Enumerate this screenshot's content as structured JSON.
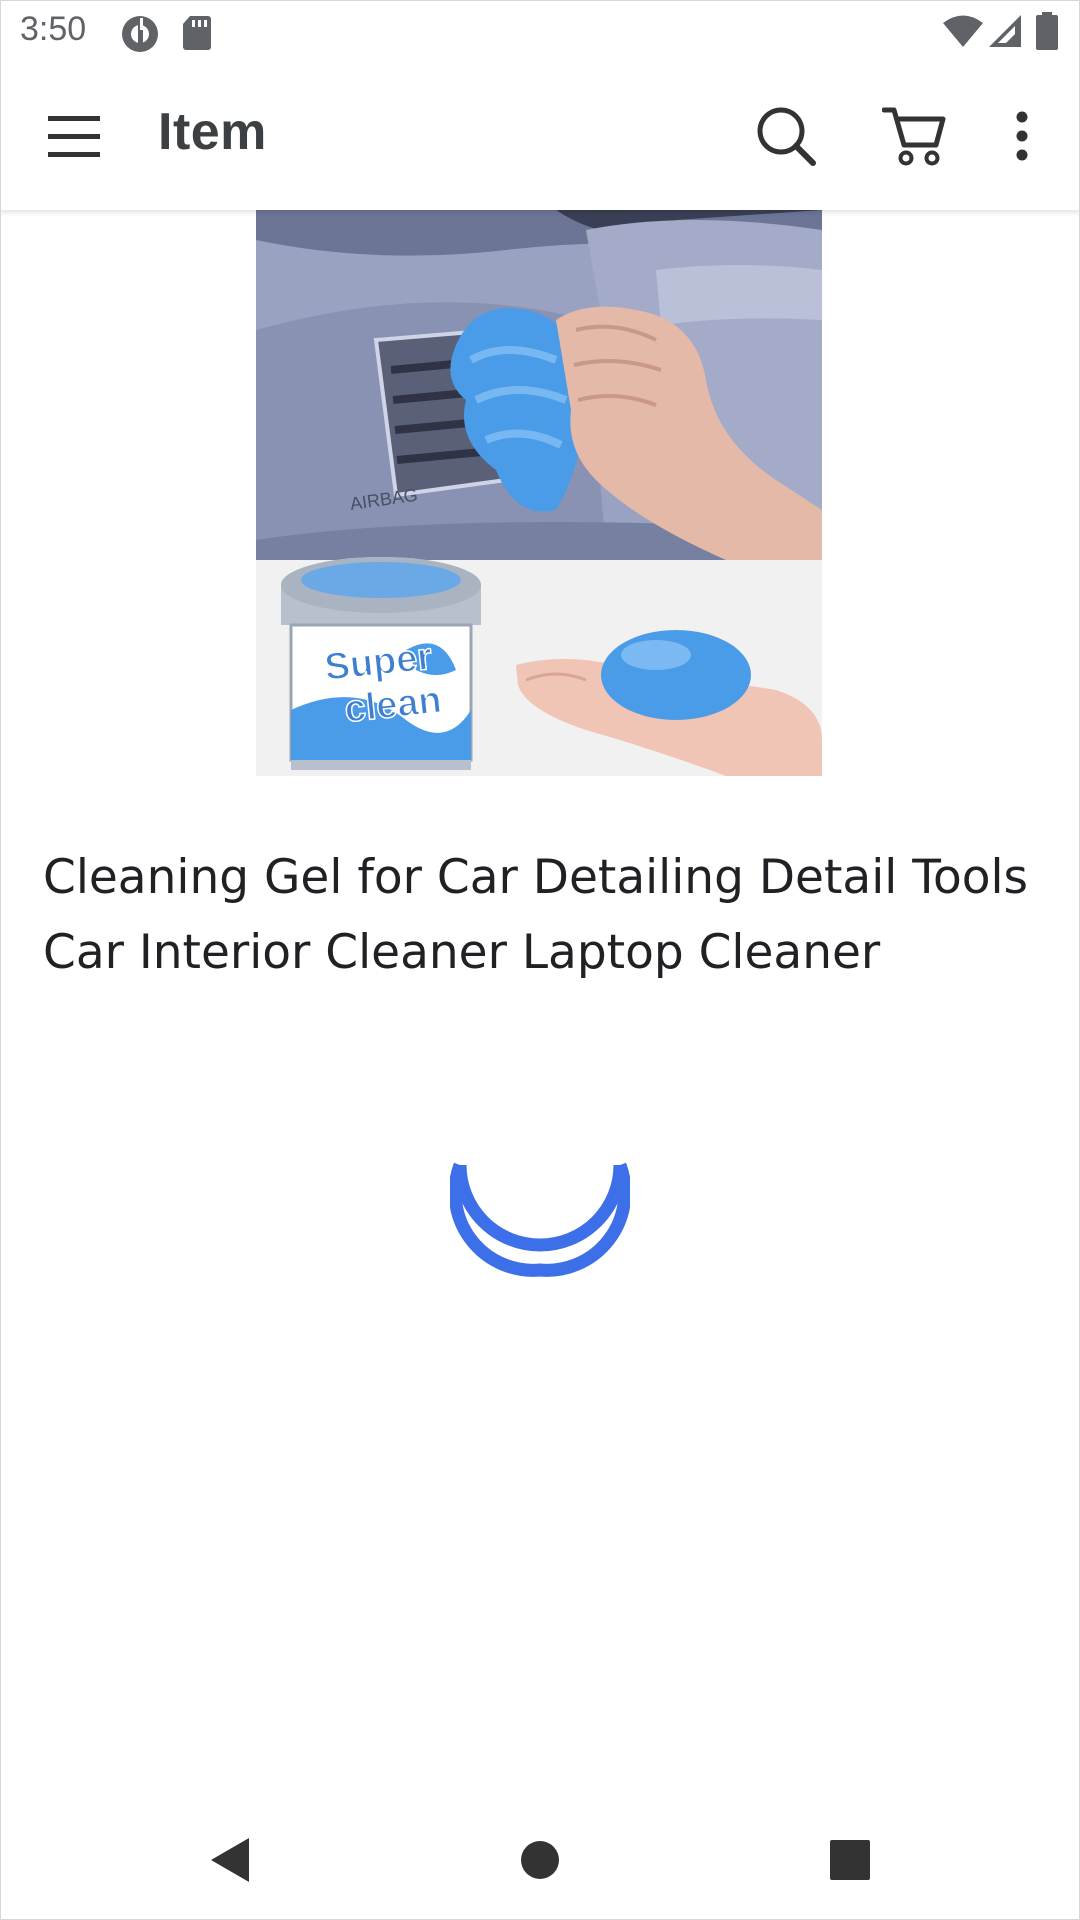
{
  "status_bar": {
    "time": "3:50",
    "icons": [
      "data-saver-icon",
      "sd-card-icon",
      "wifi-icon",
      "cellular-signal-icon",
      "battery-icon"
    ]
  },
  "app_bar": {
    "title": "Item",
    "menu_icon": "hamburger-menu-icon",
    "search_icon": "search-icon",
    "cart_icon": "shopping-cart-icon",
    "overflow_icon": "more-vert-icon"
  },
  "product": {
    "image_label_line1": "Super",
    "image_label_line2": "clean",
    "title": "Cleaning Gel for Car Detailing Detail Tools Car Interior Cleaner Laptop Cleaner"
  },
  "loading": {
    "indicator": "circular-progress-spinner",
    "color": "#3d6fe8"
  },
  "nav_bar": {
    "back_icon": "back-triangle-icon",
    "home_icon": "home-circle-icon",
    "recents_icon": "recents-square-icon"
  },
  "colors": {
    "background": "#ffffff",
    "text_primary": "#202124",
    "icon": "#333333",
    "spinner": "#3d6fe8",
    "gel_blue": "#4a9be8"
  }
}
